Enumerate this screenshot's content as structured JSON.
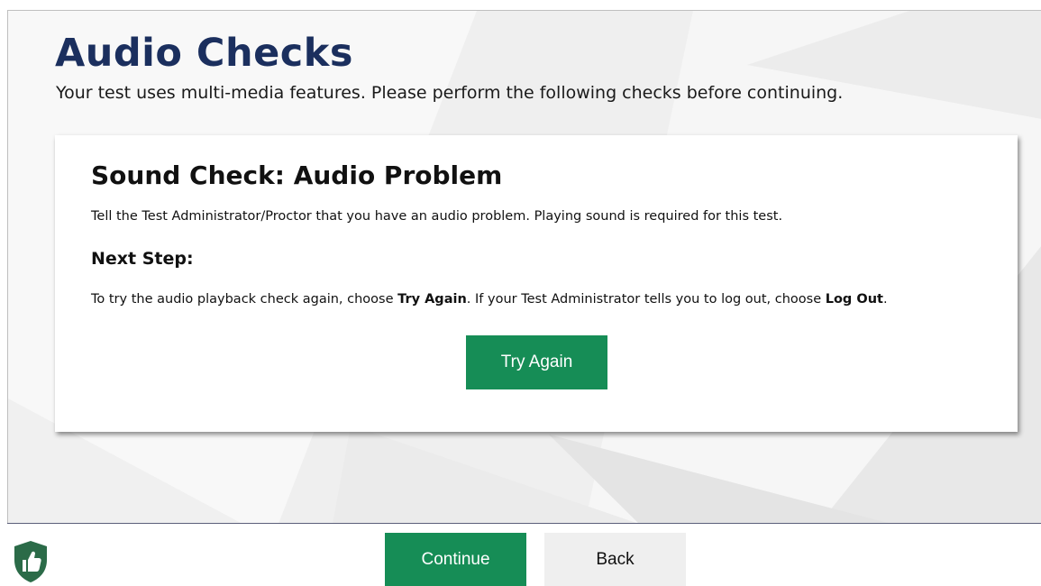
{
  "page": {
    "title": "Audio Checks",
    "subtitle": "Your test uses multi-media features. Please perform the following checks before continuing."
  },
  "card": {
    "title": "Sound Check: Audio Problem",
    "message": "Tell the Test Administrator/Proctor that you have an audio problem. Playing sound is required for this test.",
    "next_step_heading": "Next Step:",
    "instructions": {
      "part1": "To try the audio playback check again, choose ",
      "try_again_bold": "Try Again",
      "part2": ". If your Test Administrator tells you to log out, choose ",
      "log_out_bold": "Log Out",
      "part3": "."
    },
    "try_again_label": "Try Again"
  },
  "footer": {
    "continue_label": "Continue",
    "back_label": "Back",
    "help_icon": "thumbs-up-shield-icon"
  },
  "colors": {
    "title": "#1b2f5e",
    "button_green": "#168d56",
    "button_grey": "#efefef",
    "shield": "#2b6b48"
  }
}
